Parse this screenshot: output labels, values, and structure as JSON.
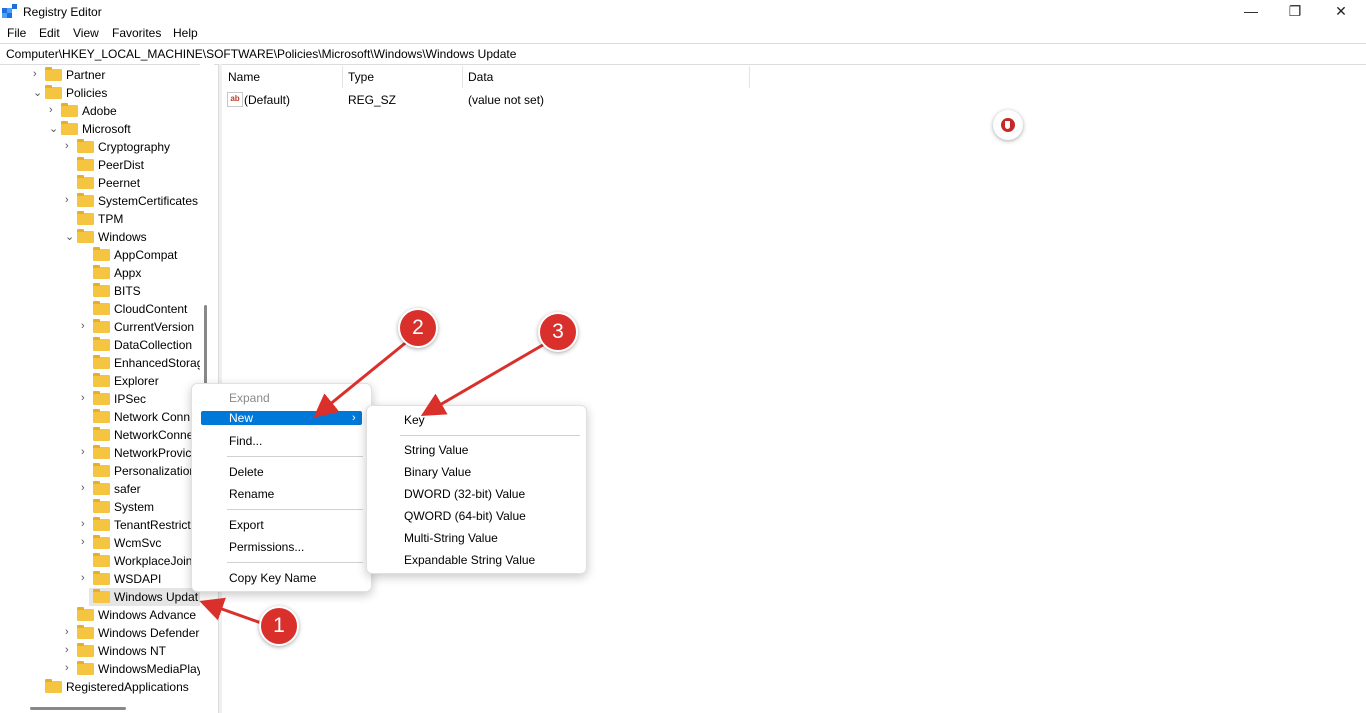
{
  "window": {
    "title": "Registry Editor",
    "controls": [
      "—",
      "❐",
      "✕"
    ]
  },
  "menu": {
    "items": [
      "File",
      "Edit",
      "View",
      "Favorites",
      "Help"
    ]
  },
  "address": {
    "path": "Computer\\HKEY_LOCAL_MACHINE\\SOFTWARE\\Policies\\Microsoft\\Windows\\Windows Update"
  },
  "tree": {
    "items": [
      {
        "label": "Partner",
        "level": 1,
        "chevron": "right"
      },
      {
        "label": "Policies",
        "level": 1,
        "chevron": "down"
      },
      {
        "label": "Adobe",
        "level": 2,
        "chevron": "right"
      },
      {
        "label": "Microsoft",
        "level": 2,
        "chevron": "down"
      },
      {
        "label": "Cryptography",
        "level": 3,
        "chevron": "right"
      },
      {
        "label": "PeerDist",
        "level": 3,
        "chevron": ""
      },
      {
        "label": "Peernet",
        "level": 3,
        "chevron": ""
      },
      {
        "label": "SystemCertificates",
        "level": 3,
        "chevron": "right"
      },
      {
        "label": "TPM",
        "level": 3,
        "chevron": ""
      },
      {
        "label": "Windows",
        "level": 3,
        "chevron": "down"
      },
      {
        "label": "AppCompat",
        "level": 4,
        "chevron": ""
      },
      {
        "label": "Appx",
        "level": 4,
        "chevron": ""
      },
      {
        "label": "BITS",
        "level": 4,
        "chevron": ""
      },
      {
        "label": "CloudContent",
        "level": 4,
        "chevron": ""
      },
      {
        "label": "CurrentVersion",
        "level": 4,
        "chevron": "right"
      },
      {
        "label": "DataCollection",
        "level": 4,
        "chevron": ""
      },
      {
        "label": "EnhancedStorag",
        "level": 4,
        "chevron": ""
      },
      {
        "label": "Explorer",
        "level": 4,
        "chevron": ""
      },
      {
        "label": "IPSec",
        "level": 4,
        "chevron": "right"
      },
      {
        "label": "Network Conn",
        "level": 4,
        "chevron": ""
      },
      {
        "label": "NetworkConne",
        "level": 4,
        "chevron": ""
      },
      {
        "label": "NetworkProvic",
        "level": 4,
        "chevron": "right"
      },
      {
        "label": "Personalization",
        "level": 4,
        "chevron": ""
      },
      {
        "label": "safer",
        "level": 4,
        "chevron": "right"
      },
      {
        "label": "System",
        "level": 4,
        "chevron": ""
      },
      {
        "label": "TenantRestricti",
        "level": 4,
        "chevron": "right"
      },
      {
        "label": "WcmSvc",
        "level": 4,
        "chevron": "right"
      },
      {
        "label": "WorkplaceJoin",
        "level": 4,
        "chevron": ""
      },
      {
        "label": "WSDAPI",
        "level": 4,
        "chevron": "right"
      },
      {
        "label": "Windows Updat",
        "level": 4,
        "chevron": "",
        "selected": true
      },
      {
        "label": "Windows Advance",
        "level": 3,
        "chevron": ""
      },
      {
        "label": "Windows Defender",
        "level": 3,
        "chevron": "right"
      },
      {
        "label": "Windows NT",
        "level": 3,
        "chevron": "right"
      },
      {
        "label": "WindowsMediaPlay",
        "level": 3,
        "chevron": "right"
      },
      {
        "label": "RegisteredApplications",
        "level": 1,
        "chevron": ""
      }
    ]
  },
  "list": {
    "columns": [
      "Name",
      "Type",
      "Data"
    ],
    "rows": [
      {
        "name": "(Default)",
        "type": "REG_SZ",
        "data": "(value not set)",
        "icon": "ab"
      }
    ]
  },
  "context_menu": {
    "expand": "Expand",
    "new": "New",
    "find": "Find...",
    "delete": "Delete",
    "rename": "Rename",
    "export": "Export",
    "permissions": "Permissions...",
    "copy_key_name": "Copy Key Name",
    "submenu_arrow": "›"
  },
  "submenu": {
    "key": "Key",
    "values": [
      "String Value",
      "Binary Value",
      "DWORD (32-bit) Value",
      "QWORD (64-bit) Value",
      "Multi-String Value",
      "Expandable String Value"
    ]
  },
  "annotations": {
    "steps": [
      "1",
      "2",
      "3"
    ],
    "color": "#d9302b"
  },
  "colors": {
    "selection": "#0078d7",
    "folder": "#f5c542"
  }
}
